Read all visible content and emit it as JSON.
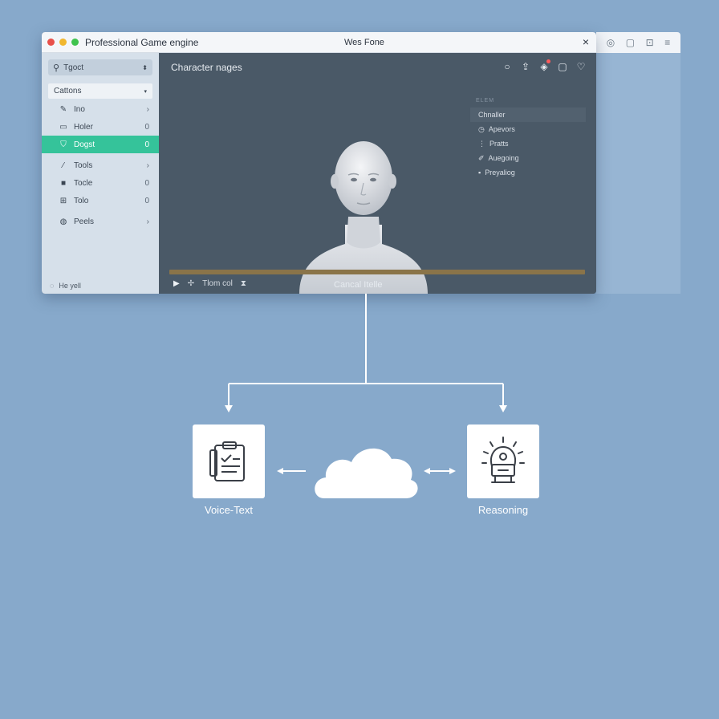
{
  "window": {
    "app_title": "Professional Game engine",
    "doc_title": "Wes Fone",
    "close_label": "×"
  },
  "sidebar": {
    "search_placeholder": "Tgoct",
    "section": "Cattons",
    "items": [
      {
        "label": "Ino",
        "end": "›",
        "icon": "wand-icon"
      },
      {
        "label": "Holer",
        "end": "0",
        "icon": "monitor-icon"
      },
      {
        "label": "Dogst",
        "end": "0",
        "icon": "shield-icon",
        "active": true
      },
      {
        "label": "Tools",
        "end": "›",
        "icon": "wand-icon"
      },
      {
        "label": "Tocle",
        "end": "0",
        "icon": "square-icon"
      },
      {
        "label": "Tolo",
        "end": "0",
        "icon": "grid-icon"
      },
      {
        "label": "Peels",
        "end": "›",
        "icon": "globe-icon"
      }
    ],
    "footer": "He yell"
  },
  "viewport": {
    "title": "Character nages",
    "panel": {
      "title": "ELEM",
      "rows": [
        {
          "label": "Chnaller",
          "icon": ""
        },
        {
          "label": "Apevors",
          "icon": "clock-icon"
        },
        {
          "label": "Pratts",
          "icon": "list-icon"
        },
        {
          "label": "Auegoing",
          "icon": "pencil-icon"
        },
        {
          "label": "Preyaliog",
          "icon": "square-icon"
        }
      ]
    },
    "transport_label": "Tlom col",
    "center_label": "Cancal Itelle"
  },
  "diagram": {
    "left_label": "Voice-Text",
    "right_label": "Reasoning"
  },
  "colors": {
    "background": "#87a9cb",
    "accent": "#35c39a",
    "viewport": "#4a5967",
    "timeline": "#8a7449"
  }
}
